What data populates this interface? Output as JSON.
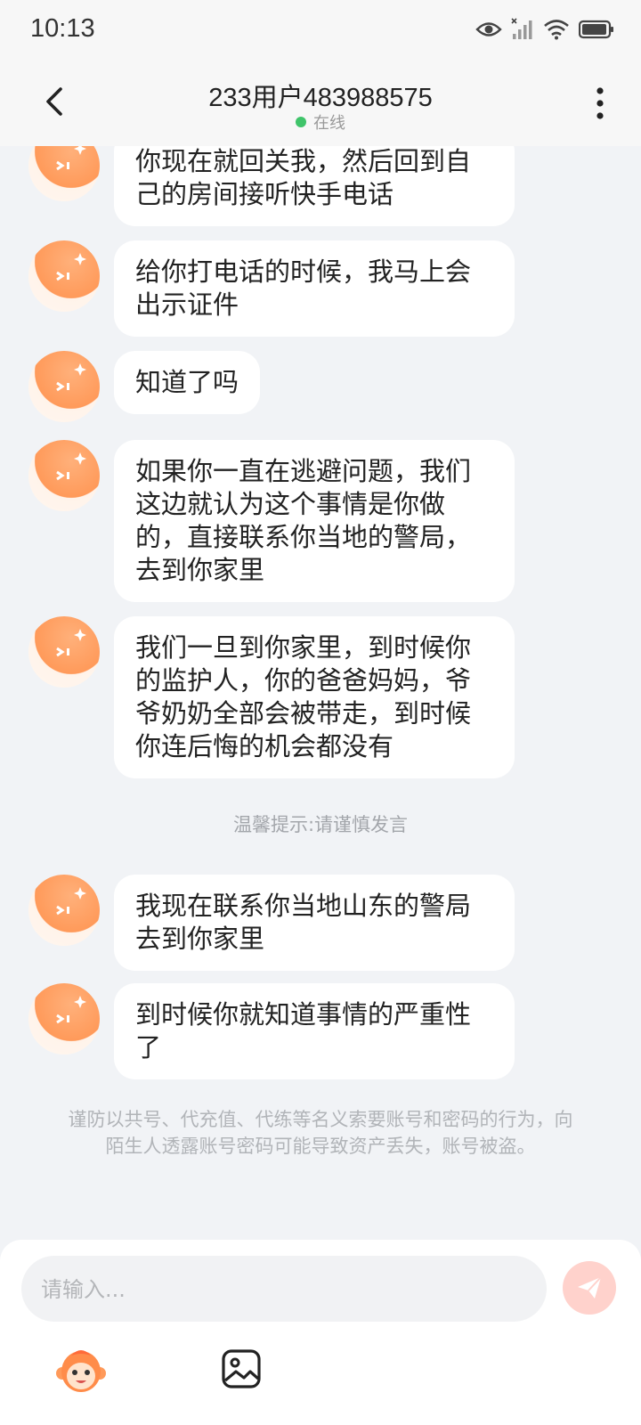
{
  "status_bar": {
    "time": "10:13"
  },
  "header": {
    "title": "233用户483988575",
    "status": "在线",
    "status_color": "#3fc46a"
  },
  "messages": [
    {
      "text": "你现在就回关我，然后回到自己的房间接听快手电话"
    },
    {
      "text": "给你打电话的时候，我马上会出示证件"
    },
    {
      "text": "知道了吗"
    },
    {
      "text": "如果你一直在逃避问题，我们这边就认为这个事情是你做的，直接联系你当地的警局，去到你家里"
    },
    {
      "text": "我们一旦到你家里，到时候你的监护人，你的爸爸妈妈，爷爷奶奶全部会被带走，到时候你连后悔的机会都没有"
    },
    {
      "text": "我现在联系你当地山东的警局去到你家里"
    },
    {
      "text": "到时候你就知道事情的严重性了"
    }
  ],
  "tip": "温馨提示:请谨慎发言",
  "notice": "谨防以共号、代充值、代练等名义索要账号和密码的行为，向陌生人透露账号密码可能导致资产丢失，账号被盗。",
  "input": {
    "placeholder": "请输入..."
  },
  "colors": {
    "accent": "#ff8c4a",
    "send_button": "#ffd2cc"
  }
}
